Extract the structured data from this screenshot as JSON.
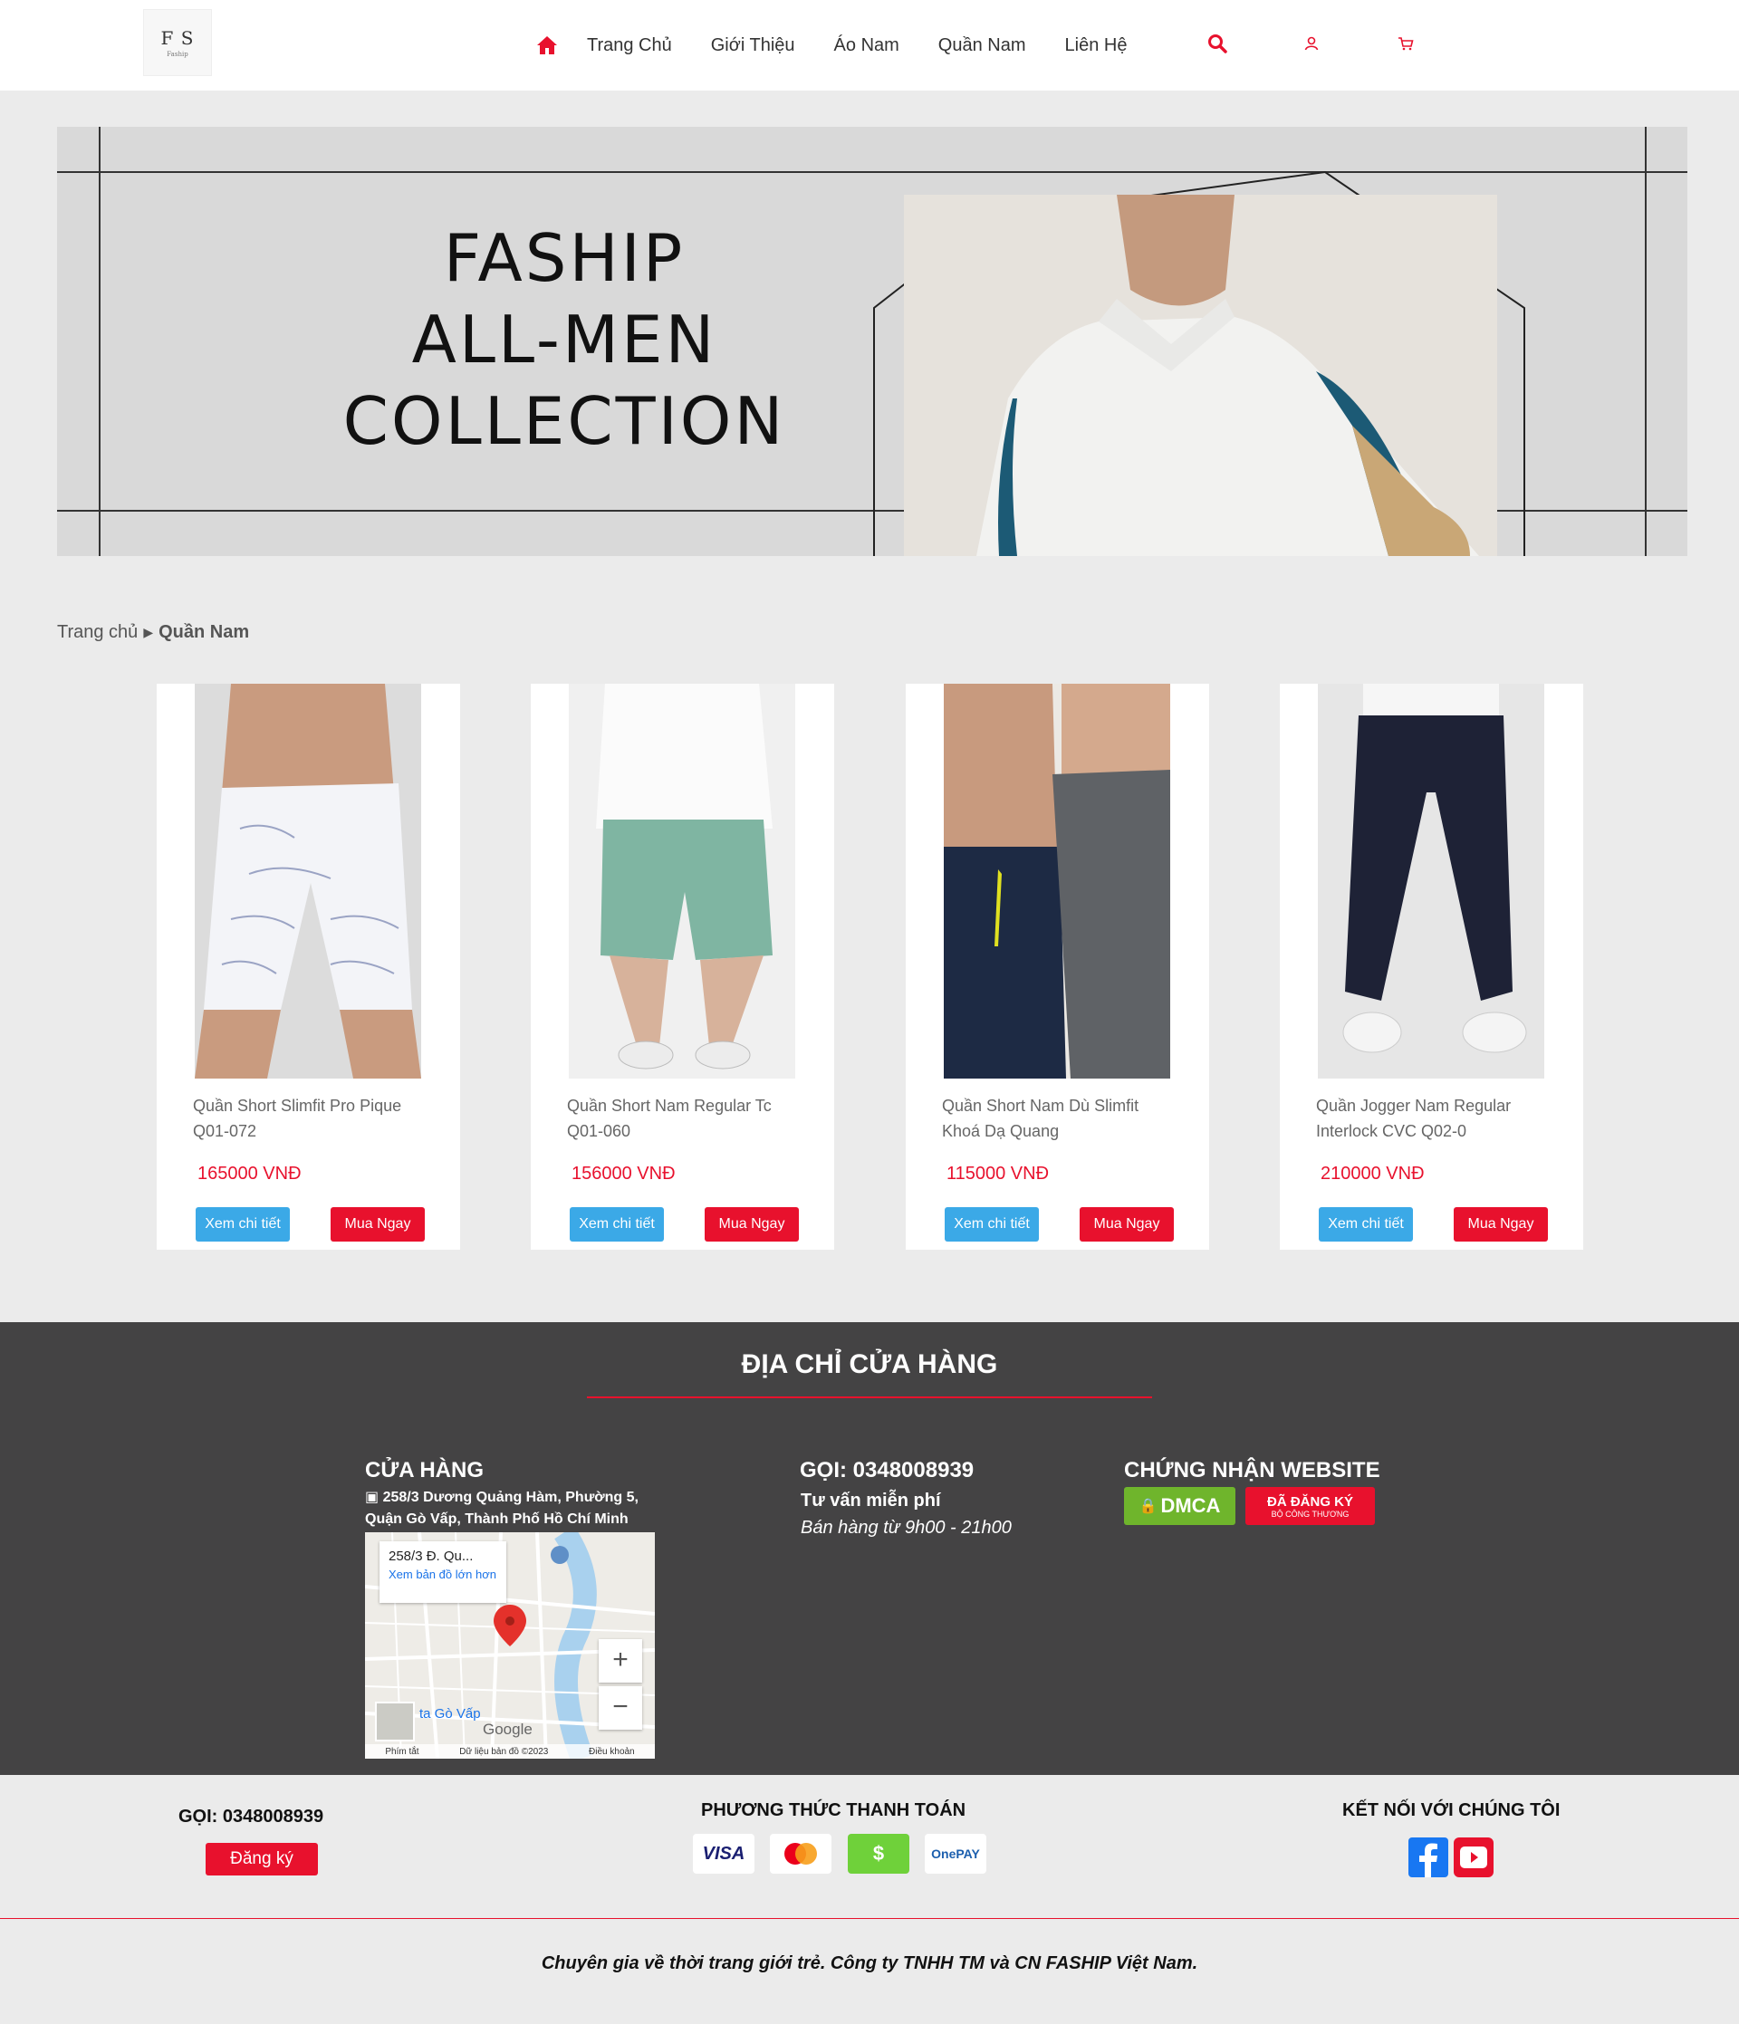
{
  "header": {
    "logo_mono": "F S",
    "logo_text": "Faship",
    "nav": [
      "Trang Chủ",
      "Giới Thiệu",
      "Áo Nam",
      "Quần Nam",
      "Liên Hệ"
    ]
  },
  "banner": {
    "line1": "FASHIP",
    "line2": "ALL-MEN",
    "line3": "COLLECTION"
  },
  "breadcrumb": {
    "home": "Trang chủ",
    "current": "Quần Nam"
  },
  "products": [
    {
      "name": "Quần Short Slimfit Pro Pique Q01-072",
      "price": "165000 VNĐ",
      "detail": "Xem chi tiết",
      "buy": "Mua Ngay"
    },
    {
      "name": "Quần Short Nam Regular Tc Q01-060",
      "price": "156000 VNĐ",
      "detail": "Xem chi tiết",
      "buy": "Mua Ngay"
    },
    {
      "name": "Quần Short Nam Dù Slimfit Khoá Dạ Quang",
      "price": "115000 VNĐ",
      "detail": "Xem chi tiết",
      "buy": "Mua Ngay"
    },
    {
      "name": "Quần Jogger Nam Regular Interlock CVC Q02-0",
      "price": "210000 VNĐ",
      "detail": "Xem chi tiết",
      "buy": "Mua Ngay"
    }
  ],
  "store": {
    "title": "ĐỊA CHỈ CỬA HÀNG",
    "shop_heading": "CỬA HÀNG",
    "address": "258/3 Dương Quảng Hàm, Phường 5, Quận Gò Vấp, Thành Phố Hồ Chí Minh",
    "map_card_title": "258/3 Đ. Qu...",
    "map_card_link": "Xem bản đồ lớn hơn",
    "map_area": "ta Gò Vấp",
    "map_brand": "Google",
    "map_footer": [
      "Phím tắt",
      "Dữ liệu bản đồ ©2023",
      "Điều khoản"
    ],
    "call_heading": "GỌI: 0348008939",
    "call_sub1": "Tư vấn miễn phí",
    "call_sub2": "Bán hàng từ 9h00 - 21h00",
    "cert_heading": "CHỨNG NHẬN WEBSITE",
    "cert_dmca": "DMCA",
    "cert_registered": "ĐÃ ĐĂNG KÝ",
    "cert_registered_sub": "BỘ CÔNG THƯƠNG"
  },
  "footer": {
    "call": "GỌI: 0348008939",
    "register": "Đăng ký",
    "payment_heading": "PHƯƠNG THỨC THANH TOÁN",
    "payments": [
      "VISA",
      "",
      "$",
      "OnePAY"
    ],
    "connect_heading": "KẾT NỐI VỚI CHÚNG TÔI",
    "copyright": "Chuyên gia về thời trang giới trẻ. Công ty TNHH TM và CN FASHIP Việt Nam."
  },
  "colors": {
    "accent": "#e8112d",
    "blue": "#3ba9e7",
    "dark": "#444344",
    "facebook": "#1877f2",
    "youtube": "#e8112d"
  }
}
